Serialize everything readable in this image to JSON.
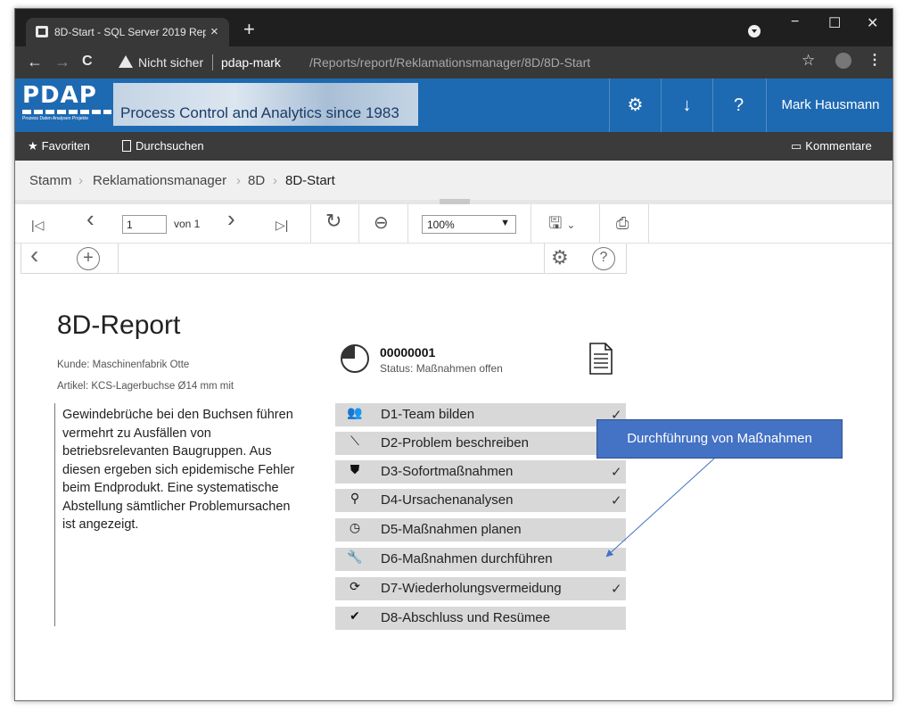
{
  "browser": {
    "tab_title": "8D-Start - SQL Server 2019 Repo",
    "tab_close": "×",
    "new_tab": "+",
    "nav": {
      "back": "←",
      "forward": "→",
      "reload": "C"
    },
    "security_label": "Nicht sicher",
    "url_host": "pdap-mark",
    "url_path": "/Reports/report/Reklamationsmanager/8D/8D-Start",
    "star": "☆",
    "menu": "⋮",
    "window_controls": {
      "minimize": "−",
      "maximize": "☐",
      "close": "✕"
    }
  },
  "header": {
    "logo_text": "PDAP",
    "logo_subtitle": "Prozess Daten Analysen Projekte",
    "banner_text": "Process Control and Analytics since 1983",
    "settings_icon": "⚙",
    "download_icon": "↓",
    "help_icon": "?",
    "user": "Mark Hausmann"
  },
  "favbar": {
    "favorites_label": "Favoriten",
    "browse_label": "Durchsuchen",
    "comments_label": "Kommentare"
  },
  "breadcrumb": {
    "items": [
      "Stamm",
      "Reklamationsmanager",
      "8D",
      "8D-Start"
    ],
    "separator": "›"
  },
  "toolbar": {
    "first_page": "|◁",
    "prev_page": "‹",
    "page_value": "1",
    "page_of": "von 1",
    "next_page": "›",
    "last_page": "▷|",
    "refresh": "↻",
    "back": "⊖",
    "zoom_value": "100%",
    "save_icon": "🖫",
    "print_icon": "⎙"
  },
  "subtoolbar": {
    "back": "‹",
    "add": "+",
    "settings": "⚙",
    "help": "?"
  },
  "report": {
    "title": "8D-Report",
    "customer": "Kunde: Maschinenfabrik Otte",
    "article": "Artikel: KCS-Lagerbuchse Ø14 mm mit",
    "description": "Gewindebrüche bei den Buchsen führen vermehrt zu Ausfällen von betriebsrelevanten Baugruppen. Aus diesen ergeben sich epidemische Fehler beim Endprodukt. Eine systematische Abstellung sämtlicher Problemursachen ist angezeigt.",
    "number": "00000001",
    "status": "Status: Maßnahmen offen",
    "progress_fraction": 0.75,
    "steps": [
      {
        "icon": "people-icon",
        "glyph": "👥",
        "label": "D1-Team bilden",
        "done": true,
        "check": "✓"
      },
      {
        "icon": "wand-icon",
        "glyph": "⟍",
        "label": "D2-Problem beschreiben",
        "done": false,
        "check": ""
      },
      {
        "icon": "shield-icon",
        "glyph": "⛊",
        "label": "D3-Sofortmaßnahmen",
        "done": true,
        "check": "✓"
      },
      {
        "icon": "search-icon",
        "glyph": "⚲",
        "label": "D4-Ursachenanalysen",
        "done": true,
        "check": "✓"
      },
      {
        "icon": "clock-icon",
        "glyph": "◷",
        "label": "D5-Maßnahmen planen",
        "done": false,
        "check": ""
      },
      {
        "icon": "wrench-icon",
        "glyph": "🔧",
        "label": "D6-Maßnahmen durchführen",
        "done": false,
        "check": ""
      },
      {
        "icon": "cycle-icon",
        "glyph": "⟳",
        "label": "D7-Wiederholungsvermeidung",
        "done": true,
        "check": "✓"
      },
      {
        "icon": "checkmark-icon",
        "glyph": "✔",
        "label": "D8-Abschluss und Resümee",
        "done": false,
        "check": ""
      }
    ]
  },
  "callout": {
    "text": "Durchführung von Maßnahmen"
  },
  "colors": {
    "header_blue": "#1e6ab2",
    "callout_blue": "#4472c4",
    "step_grey": "#d8d8d8"
  }
}
